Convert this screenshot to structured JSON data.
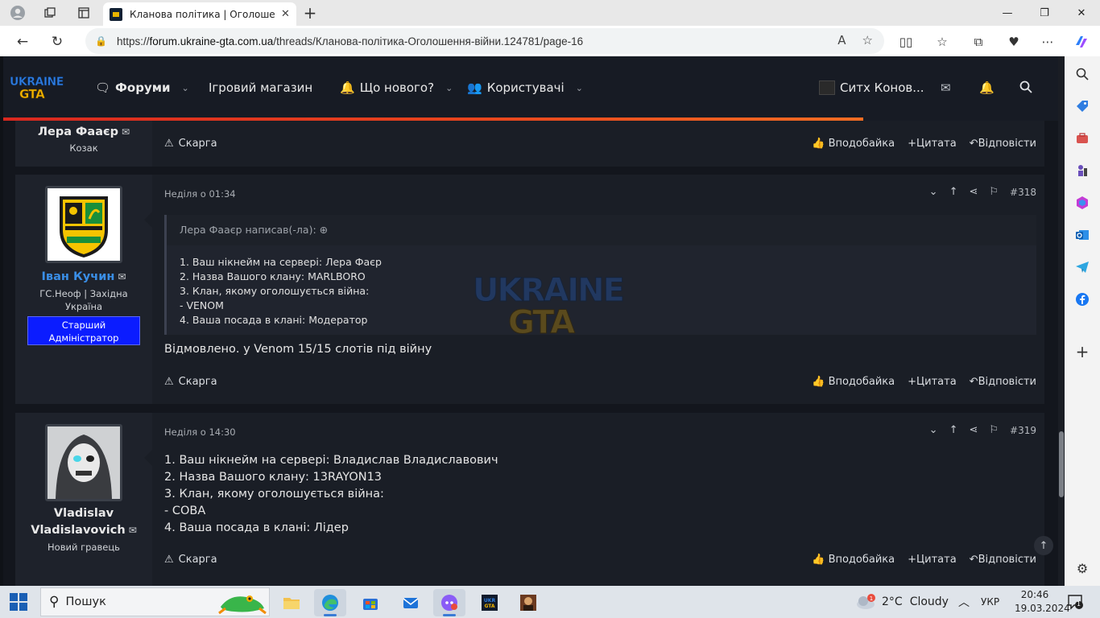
{
  "browser": {
    "tab_title": "Кланова політика | Оголошення війни",
    "url_prefix": "https://",
    "url_host": "forum.ukraine-gta.com.ua",
    "url_path": "/threads/Кланова-політика-Оголошення-війни.124781/page-16"
  },
  "site": {
    "logo_top": "UKRAINE",
    "logo_bottom": "GTA",
    "nav": {
      "forums": "Форуми",
      "shop": "Ігровий магазин",
      "whats_new": "Що нового?",
      "members": "Користувачі",
      "user": "Ситх Конов..."
    }
  },
  "posts": [
    {
      "user": "Лера Фааєр",
      "user_title": "Козак",
      "report": "Скарга",
      "like": "Вподобайка",
      "quote": "Цитата",
      "reply": "Відповісти"
    },
    {
      "user": "Іван Кучин",
      "user_title_1": "ГС.Неоф | Західна",
      "user_title_2": "Україна",
      "badge_1": "Старший",
      "badge_2": "Адміністратор",
      "date": "Неділя о 01:34",
      "number": "#318",
      "quote_author": "Лера Фааєр написав(-ла):",
      "quote_lines": [
        "1. Ваш нікнейм на сервері: Лера Фаєр",
        "2. Назва Вашого клану: MARLBORO",
        "3. Клан, якому оголошується війна:",
        "- VENOM",
        "4. Ваша посада в клані: Модератор"
      ],
      "text": "Відмовлено. у Venom 15/15 слотів під війну",
      "report": "Скарга",
      "like": "Вподобайка",
      "quote": "Цитата",
      "reply": "Відповісти"
    },
    {
      "user_1": "Vladislav",
      "user_2": "Vladislavovich",
      "user_title": "Новий гравець",
      "date": "Неділя о 14:30",
      "number": "#319",
      "lines": [
        "1. Ваш нікнейм на сервері: Владислав Владиславович",
        "2. Назва Вашого клану: 13RAYON13",
        "3. Клан, якому оголошується війна:",
        "- COBA",
        "4. Ваша посада в клані: Лідер"
      ],
      "report": "Скарга",
      "like": "Вподобайка",
      "quote": "Цитата",
      "reply": "Відповісти"
    }
  ],
  "taskbar": {
    "search": "Пошук",
    "weather_temp": "2°C",
    "weather_text": "Cloudy",
    "lang": "УКР",
    "time": "20:46",
    "date": "19.03.2024",
    "notif_count": "1"
  },
  "colors": {
    "accent_line": "#e8451d",
    "admin_badge": "#0b1cff",
    "username_blue": "#3a8ee6"
  }
}
